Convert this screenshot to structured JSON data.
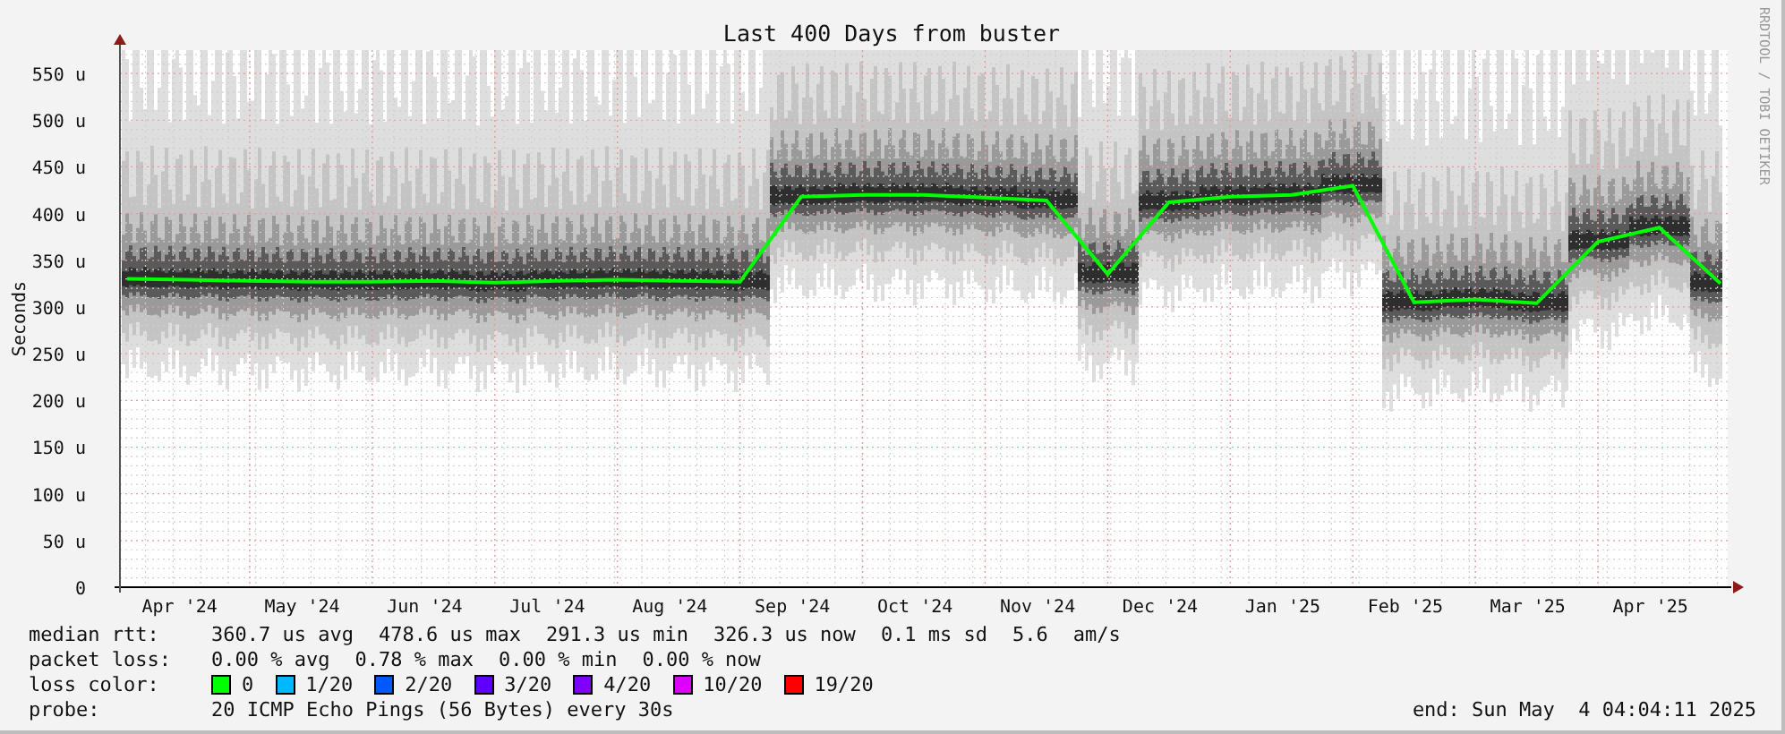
{
  "chart": {
    "vertical_label": "RRDTOOL / TOBI OETIKER",
    "chart_data": {
      "type": "line",
      "title": "Last 400 Days from buster",
      "ylabel": "Seconds",
      "categories": [
        null,
        "Apr '24",
        null,
        "May '24",
        null,
        "Jun '24",
        null,
        "Jul '24",
        null,
        "Aug '24",
        null,
        "Sep '24",
        null,
        "Oct '24",
        null,
        "Nov '24",
        null,
        "Dec '24",
        null,
        "Jan '25",
        null,
        "Feb '25",
        null,
        "Mar '25",
        null,
        "Apr '25",
        null
      ],
      "series": [
        {
          "name": "median rtt:",
          "color": "#00ff00",
          "values": [
            330,
            329,
            328,
            327,
            327,
            328,
            326,
            328,
            329,
            328,
            327,
            418,
            420,
            420,
            417,
            414,
            335,
            412,
            418,
            420,
            430,
            305,
            308,
            304,
            370,
            385,
            325
          ]
        }
      ],
      "ylim": [
        0,
        575
      ],
      "grid": true,
      "yticks": [
        {
          "value": 0,
          "label": "0"
        },
        {
          "value": 50,
          "label": "50 u"
        },
        {
          "value": 100,
          "label": "100 u"
        },
        {
          "value": 150,
          "label": "150 u"
        },
        {
          "value": 200,
          "label": "200 u"
        },
        {
          "value": 250,
          "label": "250 u"
        },
        {
          "value": 300,
          "label": "300 u"
        },
        {
          "value": 350,
          "label": "350 u"
        },
        {
          "value": 400,
          "label": "400 u"
        },
        {
          "value": 450,
          "label": "450 u"
        },
        {
          "value": 500,
          "label": "500 u"
        },
        {
          "value": 550,
          "label": "550 u"
        }
      ]
    }
  },
  "legend": {
    "median_rtt": {
      "values": [
        "360.7 us avg",
        "478.6 us max",
        "291.3 us min",
        "326.3 us now",
        "0.1 ms sd",
        "5.6",
        "am/s"
      ]
    },
    "packet_loss": {
      "label": "packet loss:",
      "values": [
        "0.00 % avg",
        "0.78 % max",
        "0.00 % min",
        "0.00 % now"
      ]
    },
    "loss_color": {
      "label": "loss color:",
      "items": [
        {
          "label": "0",
          "color": "#00ff00"
        },
        {
          "label": "1/20",
          "color": "#00b8ff"
        },
        {
          "label": "2/20",
          "color": "#0059ff"
        },
        {
          "label": "3/20",
          "color": "#5e00ff"
        },
        {
          "label": "4/20",
          "color": "#7e00ff"
        },
        {
          "label": "10/20",
          "color": "#dd00ff"
        },
        {
          "label": "19/20",
          "color": "#ff0000"
        }
      ]
    },
    "probe": {
      "label": "probe:",
      "value": "20 ICMP Echo Pings (56 Bytes) every 30s"
    },
    "end": "end: Sun May  4 04:04:11 2025"
  }
}
